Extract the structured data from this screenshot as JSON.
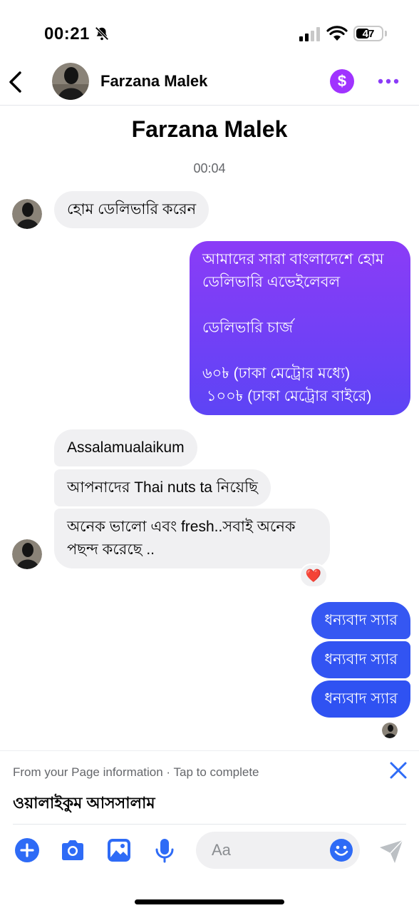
{
  "status_bar": {
    "time": "00:21",
    "battery": "47"
  },
  "header": {
    "contact_name": "Farzana Malek",
    "pay_icon": "$"
  },
  "conversation": {
    "title": "Farzana Malek",
    "timestamp": "00:04"
  },
  "messages": [
    {
      "dir": "in",
      "text": "হোম ডেলিভারি করেন"
    },
    {
      "dir": "out",
      "text": "আমাদের সারা বাংলাদেশে হোম ডেলিভারি এভেইলেবল\n\nডেলিভারি চার্জ\n\n৬০৳ (ঢাকা মেট্রোর মধ্যে)\n ১০০৳ (ঢাকা মেট্রোর বাইরে)"
    },
    {
      "dir": "in",
      "text": "Assalamualaikum"
    },
    {
      "dir": "in",
      "text": "আপনাদের Thai nuts ta নিয়েছি"
    },
    {
      "dir": "in",
      "text": "অনেক ভালো এবং fresh..সবাই অনেক পছন্দ করেছে .."
    },
    {
      "dir": "out",
      "text": "ধন্যবাদ স্যার"
    },
    {
      "dir": "out",
      "text": "ধন্যবাদ স্যার"
    },
    {
      "dir": "out",
      "text": "ধন্যবাদ স্যার"
    }
  ],
  "reaction": {
    "emoji": "❤️"
  },
  "suggestion": {
    "info": "From your Page information · Tap to complete",
    "text": "ওয়ালাইকুম আসসালাম"
  },
  "composer": {
    "placeholder": "Aa"
  },
  "colors": {
    "accent": "#2e6bf6",
    "gradient_top": "#8b3cf7",
    "gradient_bottom": "#5d44f5",
    "pay": "#a033ff",
    "incoming_bubble": "#f0f0f2"
  },
  "icons": [
    "back-chevron-icon",
    "dollar-icon",
    "more-dots-icon",
    "close-icon",
    "plus-icon",
    "camera-icon",
    "gallery-icon",
    "microphone-icon",
    "emoji-icon",
    "send-icon",
    "bell-off-icon",
    "signal-icon",
    "wifi-icon",
    "battery-icon"
  ]
}
